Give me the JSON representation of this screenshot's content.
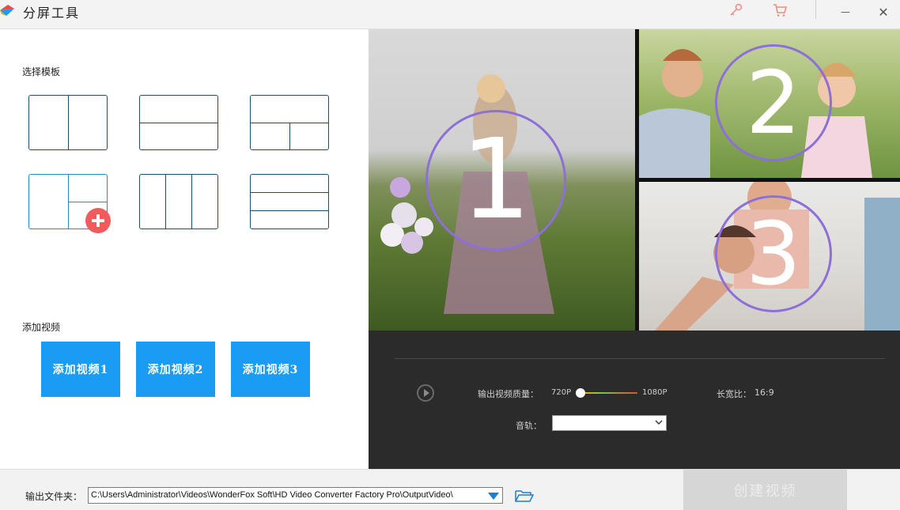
{
  "app": {
    "title": "分屏工具",
    "accent_color": "#1a9cf5",
    "icons": [
      "app-logo-icon",
      "key-icon",
      "cart-icon",
      "minimize-icon",
      "close-icon"
    ]
  },
  "window_controls": {
    "minimize": "—",
    "close": "✕"
  },
  "template_section": {
    "label": "选择模板",
    "templates": [
      {
        "name": "two-columns"
      },
      {
        "name": "two-rows"
      },
      {
        "name": "top-full-bottom-split"
      },
      {
        "name": "left-full-right-split",
        "selected": true
      },
      {
        "name": "three-columns"
      },
      {
        "name": "three-rows"
      }
    ]
  },
  "add_video_section": {
    "label": "添加视频",
    "buttons": [
      "添加视频1",
      "添加视频2",
      "添加视频3"
    ]
  },
  "preview": {
    "panes": [
      {
        "number": "1"
      },
      {
        "number": "2"
      },
      {
        "number": "3"
      }
    ]
  },
  "controls": {
    "quality_label": "输出视频质量：",
    "quality_min": "720P",
    "quality_max": "1080P",
    "quality_value_fraction": 0.0,
    "aspect_label": "长宽比：",
    "aspect_value": "16:9",
    "audio_label": "音轨：",
    "audio_value": ""
  },
  "bottom": {
    "output_label": "输出文件夹：",
    "output_path": "C:\\Users\\Administrator\\Videos\\WonderFox Soft\\HD Video Converter Factory Pro\\OutputVideo\\",
    "create_button": "创建视频"
  }
}
